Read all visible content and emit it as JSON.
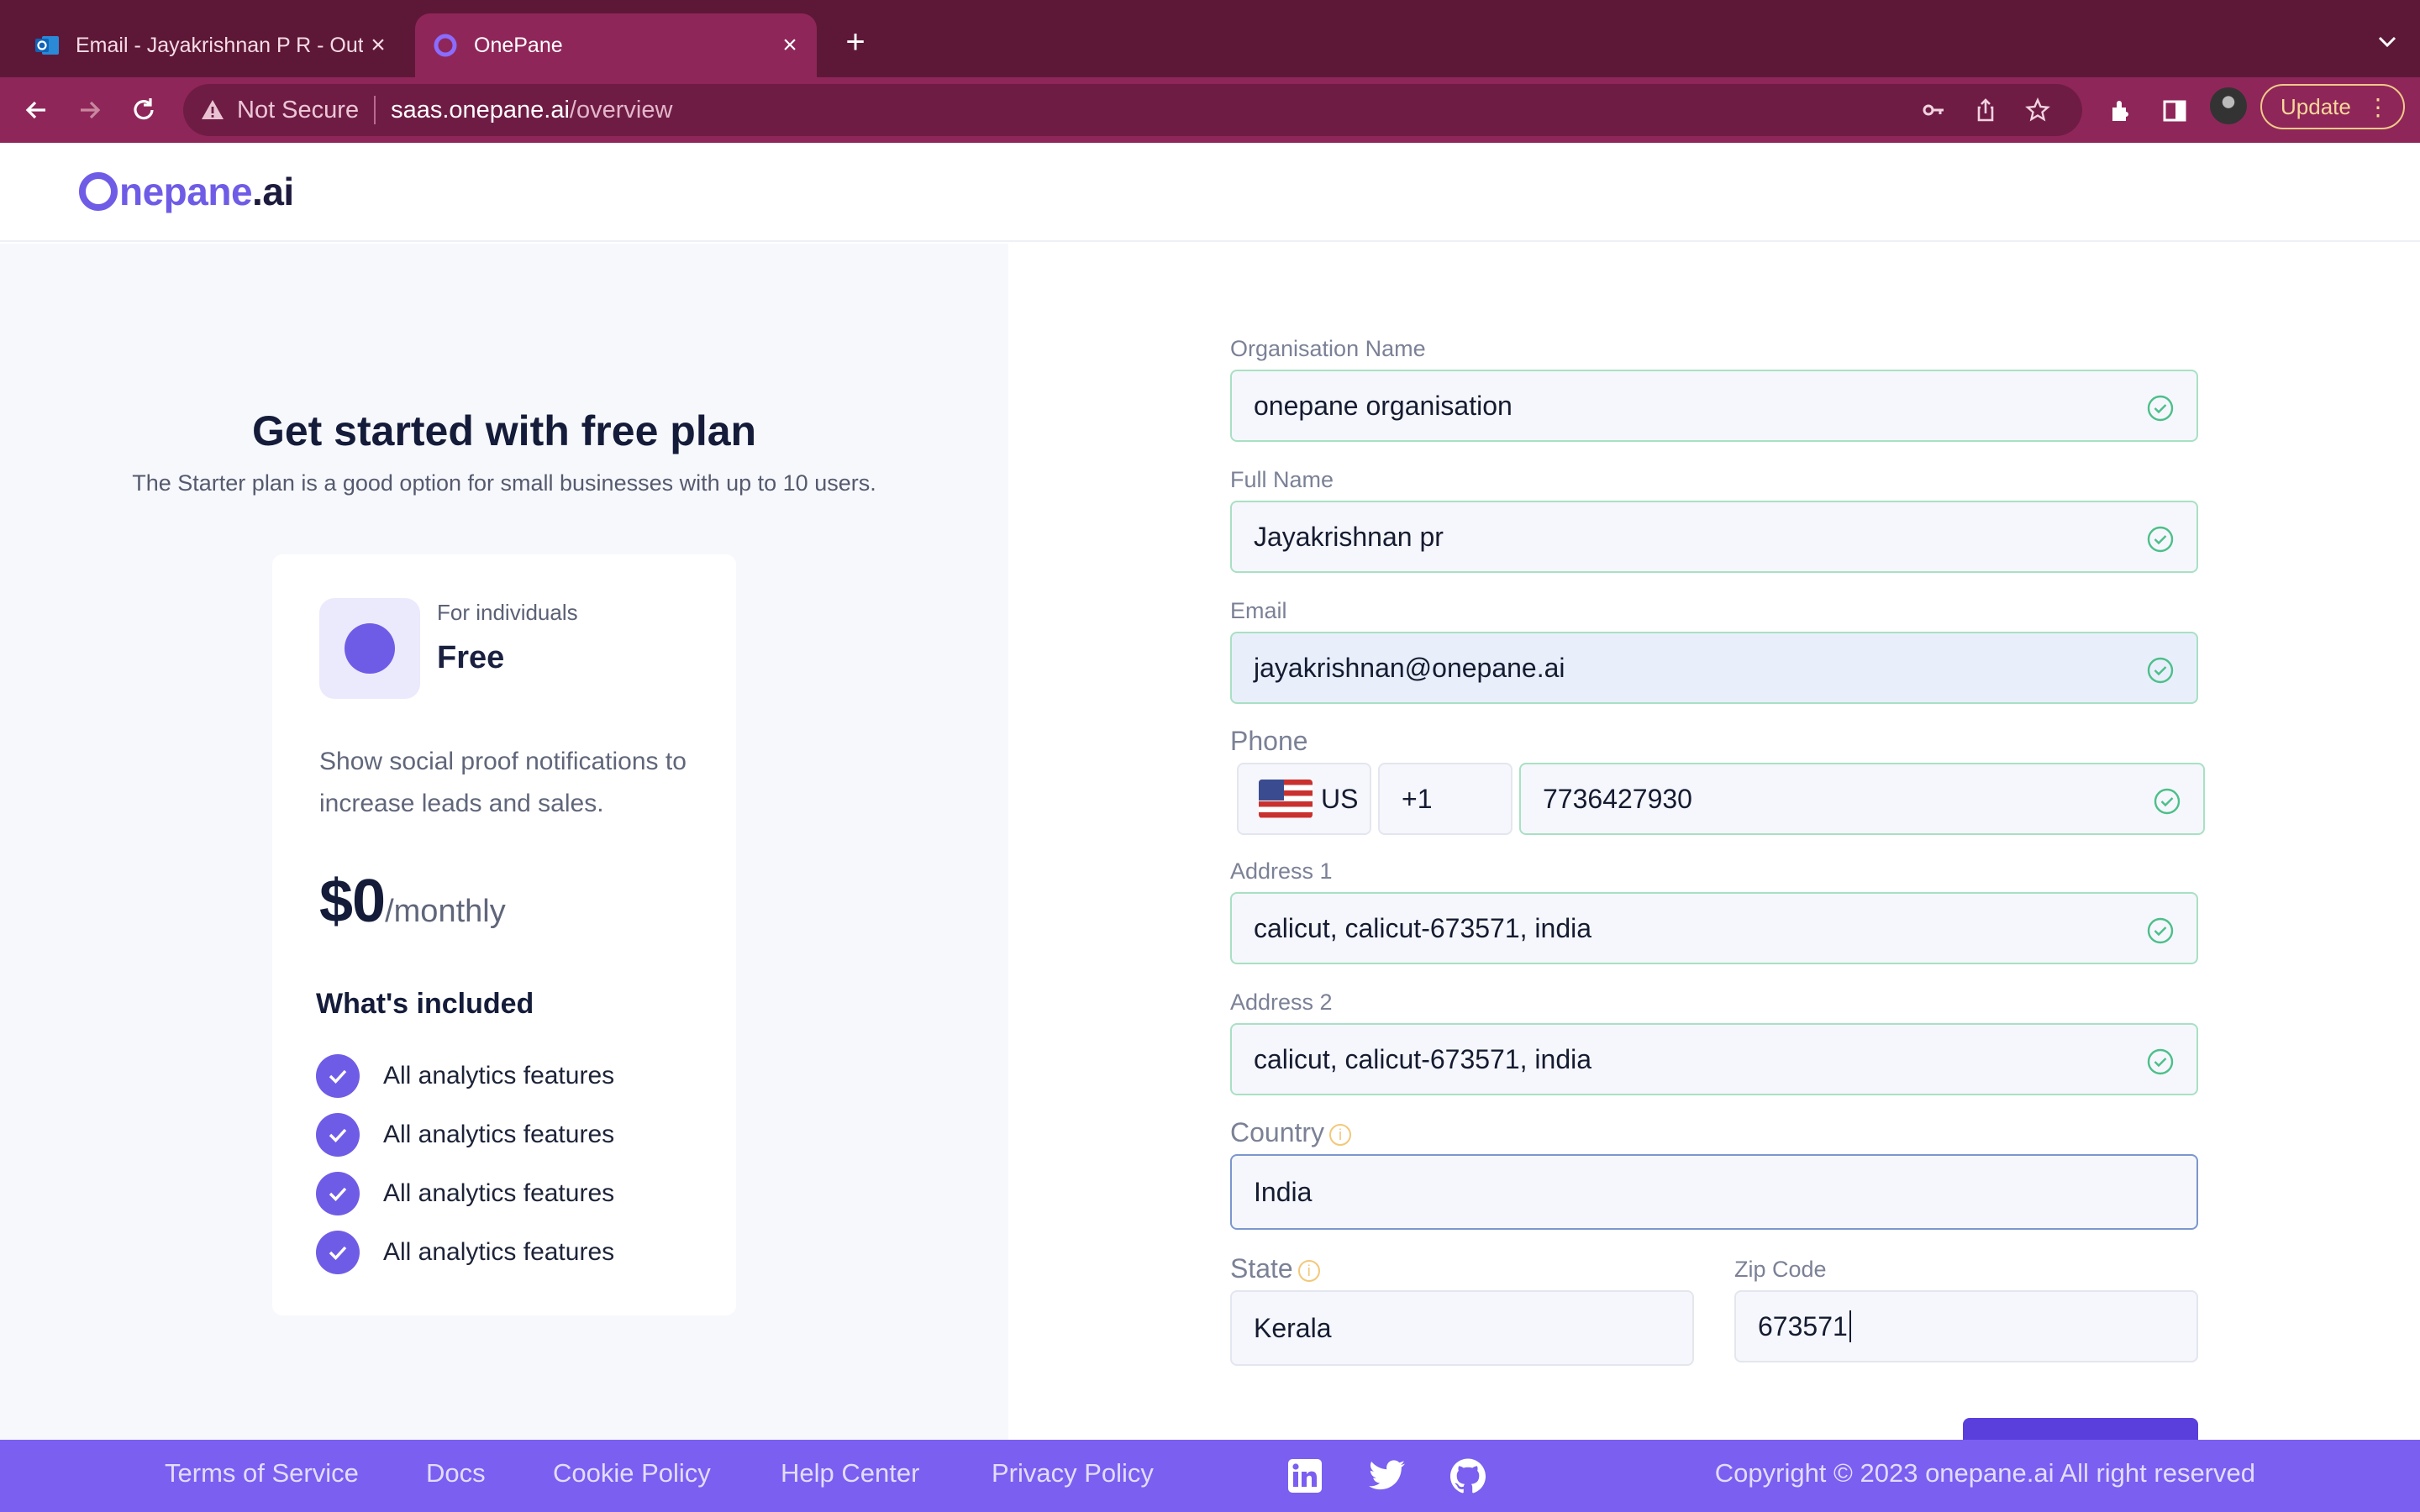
{
  "browser": {
    "tabs": [
      {
        "title": "Email - Jayakrishnan P R - Outlook",
        "active": false
      },
      {
        "title": "OnePane",
        "active": true
      }
    ],
    "address": {
      "security_label": "Not Secure",
      "host": "saas.onepane.ai",
      "path": "/overview"
    },
    "update_label": "Update"
  },
  "header": {
    "logo_main": "nepane",
    "logo_suffix": ".ai"
  },
  "plan": {
    "title": "Get started with free plan",
    "subtitle": "The Starter plan is a good option for small businesses with up to 10 users.",
    "for_label": "For individuals",
    "name": "Free",
    "description": "Show social proof notifications to increase leads and sales.",
    "price": "$0",
    "period": "/monthly",
    "included_title": "What's included",
    "features": [
      "All analytics features",
      "All analytics features",
      "All analytics features",
      "All analytics features"
    ]
  },
  "form": {
    "organisation": {
      "label": "Organisation Name",
      "value": "onepane organisation"
    },
    "full_name": {
      "label": "Full Name",
      "value": "Jayakrishnan pr"
    },
    "email": {
      "label": "Email",
      "value": "jayakrishnan@onepane.ai"
    },
    "phone": {
      "label": "Phone",
      "country_code": "US",
      "dial_code": "+1",
      "value": "7736427930"
    },
    "address1": {
      "label": "Address 1",
      "value": "calicut, calicut-673571, india"
    },
    "address2": {
      "label": "Address 2",
      "value": "calicut, calicut-673571, india"
    },
    "country": {
      "label": "Country",
      "value": "India"
    },
    "state": {
      "label": "State",
      "value": "Kerala"
    },
    "zip": {
      "label": "Zip Code",
      "value": "673571"
    }
  },
  "footer": {
    "links": [
      "Terms of Service",
      "Docs",
      "Cookie Policy",
      "Help Center",
      "Privacy Policy"
    ],
    "social_icons": [
      "linkedin-icon",
      "twitter-icon",
      "github-icon"
    ],
    "copyright": "Copyright © 2023 onepane.ai All right reserved"
  },
  "colors": {
    "brand": "#6f5ce6",
    "footer": "#7b5ff0",
    "tabbar": "#5e1837",
    "toolbar": "#8f2659",
    "valid_border": "#a9e0c4",
    "valid_check": "#4dbf8a"
  }
}
